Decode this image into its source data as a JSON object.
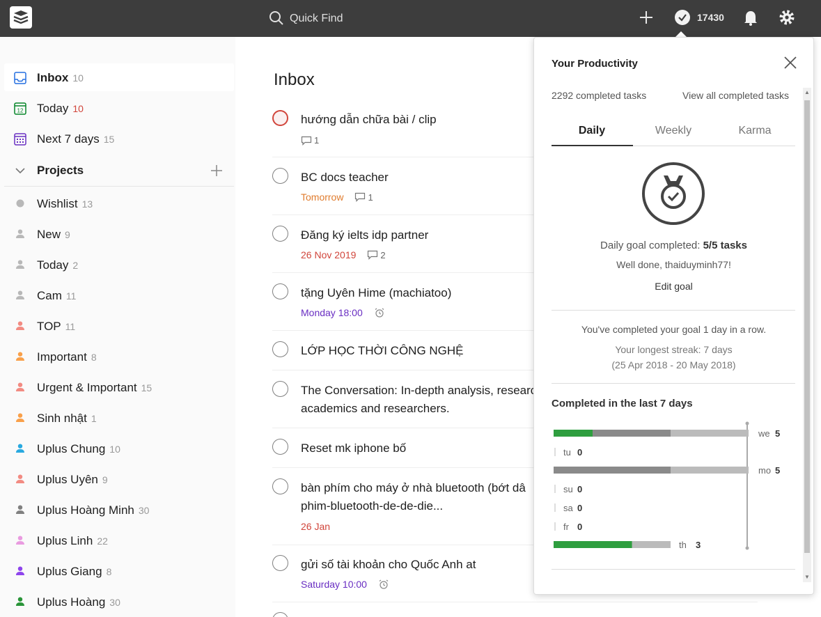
{
  "topbar": {
    "search_placeholder": "Quick Find",
    "karma": "17430"
  },
  "sidebar": {
    "filters": [
      {
        "label": "Inbox",
        "count": "10",
        "active": true
      },
      {
        "label": "Today",
        "count": "10",
        "count_red": true
      },
      {
        "label": "Next 7 days",
        "count": "15"
      }
    ],
    "projects_label": "Projects",
    "projects": [
      {
        "label": "Wishlist",
        "count": "13",
        "color": "#b8b8b8"
      },
      {
        "label": "New",
        "count": "9",
        "color": "#b8b8b8"
      },
      {
        "label": "Today",
        "count": "2",
        "color": "#b8b8b8"
      },
      {
        "label": "Cam",
        "count": "11",
        "color": "#b8b8b8"
      },
      {
        "label": "TOP",
        "count": "11",
        "color": "#f28b82"
      },
      {
        "label": "Important",
        "count": "8",
        "color": "#f9a04a"
      },
      {
        "label": "Urgent & Important",
        "count": "15",
        "color": "#f28b82"
      },
      {
        "label": "Sinh nhật",
        "count": "1",
        "color": "#f9a04a"
      },
      {
        "label": "Uplus Chung",
        "count": "10",
        "color": "#29a9e0"
      },
      {
        "label": "Uplus Uyên",
        "count": "9",
        "color": "#f28b82"
      },
      {
        "label": "Uplus Hoàng Minh",
        "count": "30",
        "color": "#808080"
      },
      {
        "label": "Uplus Linh",
        "count": "22",
        "color": "#e99be0"
      },
      {
        "label": "Uplus Giang",
        "count": "8",
        "color": "#8e44ec"
      },
      {
        "label": "Uplus Hoàng",
        "count": "30",
        "color": "#299438"
      }
    ]
  },
  "main": {
    "title": "Inbox",
    "tasks": [
      {
        "title": "hướng dẫn chữa bài / clip",
        "date": "",
        "comments": "1"
      },
      {
        "title": "BC docs teacher",
        "date": "Tomorrow",
        "comments": "1"
      },
      {
        "title": "Đăng ký ielts idp partner",
        "date": "26 Nov 2019",
        "comments": "2"
      },
      {
        "title": "tặng Uyên Hime (machiatoo)",
        "date": "Monday 18:00",
        "comments": ""
      },
      {
        "title": "LỚP HỌC THỜI CÔNG NGHỆ",
        "date": "",
        "comments": ""
      },
      {
        "title": "The Conversation: In-depth analysis, researc",
        "title2": "academics and researchers.",
        "date": "",
        "comments": ""
      },
      {
        "title": "Reset mk iphone bố",
        "date": "",
        "comments": ""
      },
      {
        "title": "bàn phím cho máy ở nhà bluetooth (bớt dâ",
        "title2": "phim-bluetooth-de-de-die...",
        "date": "26 Jan",
        "comments": ""
      },
      {
        "title": "gửi số tài khoản cho Quốc Anh at",
        "date": "Saturday 10:00",
        "comments": ""
      }
    ]
  },
  "productivity": {
    "title": "Your Productivity",
    "completed_tasks": "2292 completed tasks",
    "view_all": "View all completed tasks",
    "tabs": [
      "Daily",
      "Weekly",
      "Karma"
    ],
    "goal_prefix": "Daily goal completed: ",
    "goal_value": "5/5 tasks",
    "well_done": "Well done, thaiduyminh77!",
    "edit_goal": "Edit goal",
    "streak_current": "You've completed your goal 1 day in a row.",
    "streak_longest": "Your longest streak: 7 days",
    "streak_range": "(25 Apr 2018 - 20 May 2018)",
    "last7_title": "Completed in the last 7 days"
  },
  "chart_data": {
    "type": "bar",
    "categories": [
      "we",
      "tu",
      "mo",
      "su",
      "sa",
      "fr",
      "th"
    ],
    "values": [
      5,
      0,
      5,
      0,
      0,
      0,
      3
    ],
    "goal": 5,
    "colors": {
      "green": "#2e9e3f",
      "dark": "#8a8a8a",
      "light": "#bbbbbb"
    }
  }
}
